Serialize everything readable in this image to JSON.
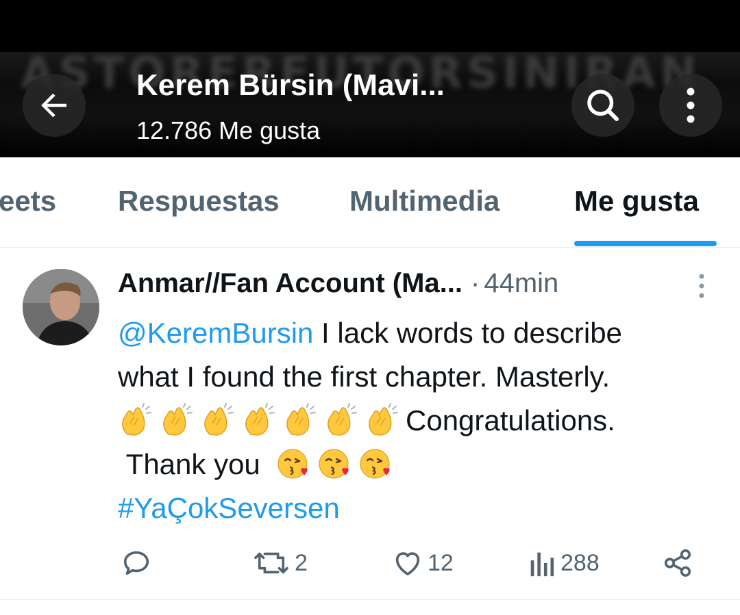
{
  "header": {
    "title": "Kerem Bürsin (Mavi...",
    "subtitle": "12.786 Me gusta",
    "banner_ghost_text": "ASTORERFUTORSINIRAN"
  },
  "tabs": [
    {
      "label": "Tweets",
      "visible_label": "eets"
    },
    {
      "label": "Respuestas"
    },
    {
      "label": "Multimedia"
    },
    {
      "label": "Me gusta",
      "active": true
    }
  ],
  "tweet": {
    "author": "Anmar//Fan Account (Ma...",
    "separator": "·",
    "time": "44min",
    "mention": "@KeremBursin",
    "text_line1": " I lack words to describe",
    "text_line2": "what I found the first chapter. Masterly.",
    "clap_count": 7,
    "text_line3": "Congratulations.",
    "text_line4": "Thank you",
    "kiss_count": 3,
    "hashtag": "#YaÇokSeversen"
  },
  "actions": {
    "reply_count": "",
    "retweet_count": "2",
    "like_count": "12",
    "views_count": "288"
  },
  "colors": {
    "accent": "#1d9bf0",
    "muted": "#536471",
    "text": "#0f1419",
    "header_bg": "#000000"
  },
  "icons": [
    "back-arrow-icon",
    "search-icon",
    "more-vertical-icon",
    "reply-icon",
    "retweet-icon",
    "like-icon",
    "views-icon",
    "share-icon"
  ]
}
